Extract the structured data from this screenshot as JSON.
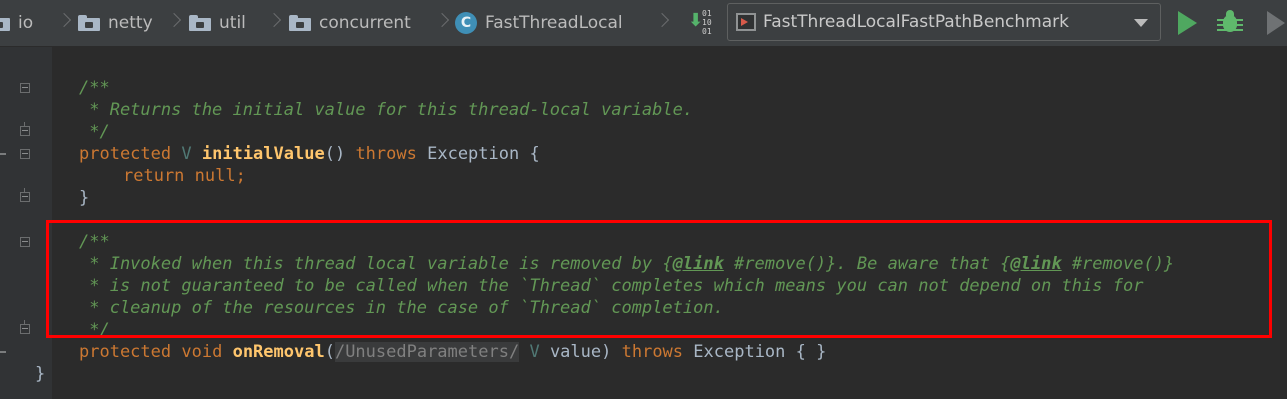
{
  "breadcrumb": {
    "items": [
      "io",
      "netty",
      "util",
      "concurrent"
    ],
    "class_label": "FastThreadLocal",
    "class_icon_letter": "C"
  },
  "toolbar": {
    "binary_bits": [
      "01",
      "10",
      "01"
    ],
    "run_configuration": "FastThreadLocalFastPathBenchmark",
    "run_icon": "run-icon",
    "debug_icon": "debug-icon"
  },
  "code": {
    "l1": "/**",
    "l2": " * Returns the initial value for this thread-local variable.",
    "l3": " */",
    "l4_kw": "protected",
    "l4_type": "V",
    "l4_method": "initialValue",
    "l4_parens": "()",
    "l4_throws": "throws",
    "l4_rest": "Exception {",
    "l5_return": "return",
    "l5_null": "null",
    "l5_semi": ";",
    "l6": "}",
    "l7": "/**",
    "l8_a": " * Invoked when this thread local variable is removed by {",
    "l8_tag1": "@link",
    "l8_b": " #remove()}. Be aware that {",
    "l8_tag2": "@link",
    "l8_c": " #remove()}",
    "l9": " * is not guaranteed to be called when the `Thread` completes which means you can not depend on this for",
    "l10": " * cleanup of the resources in the case of `Thread` completion.",
    "l11": " */",
    "l12_kw": "protected",
    "l12_void": "void",
    "l12_method": "onRemoval",
    "l12_open": "(",
    "l12_comment": "/UnusedParameters/",
    "l12_type": "V",
    "l12_param": "value)",
    "l12_throws": "throws",
    "l12_rest": "Exception { }",
    "l13": "}"
  },
  "colors": {
    "highlight_box": "#ff0000",
    "keyword": "#cc7832",
    "comment": "#629755",
    "method": "#ffc66d"
  }
}
